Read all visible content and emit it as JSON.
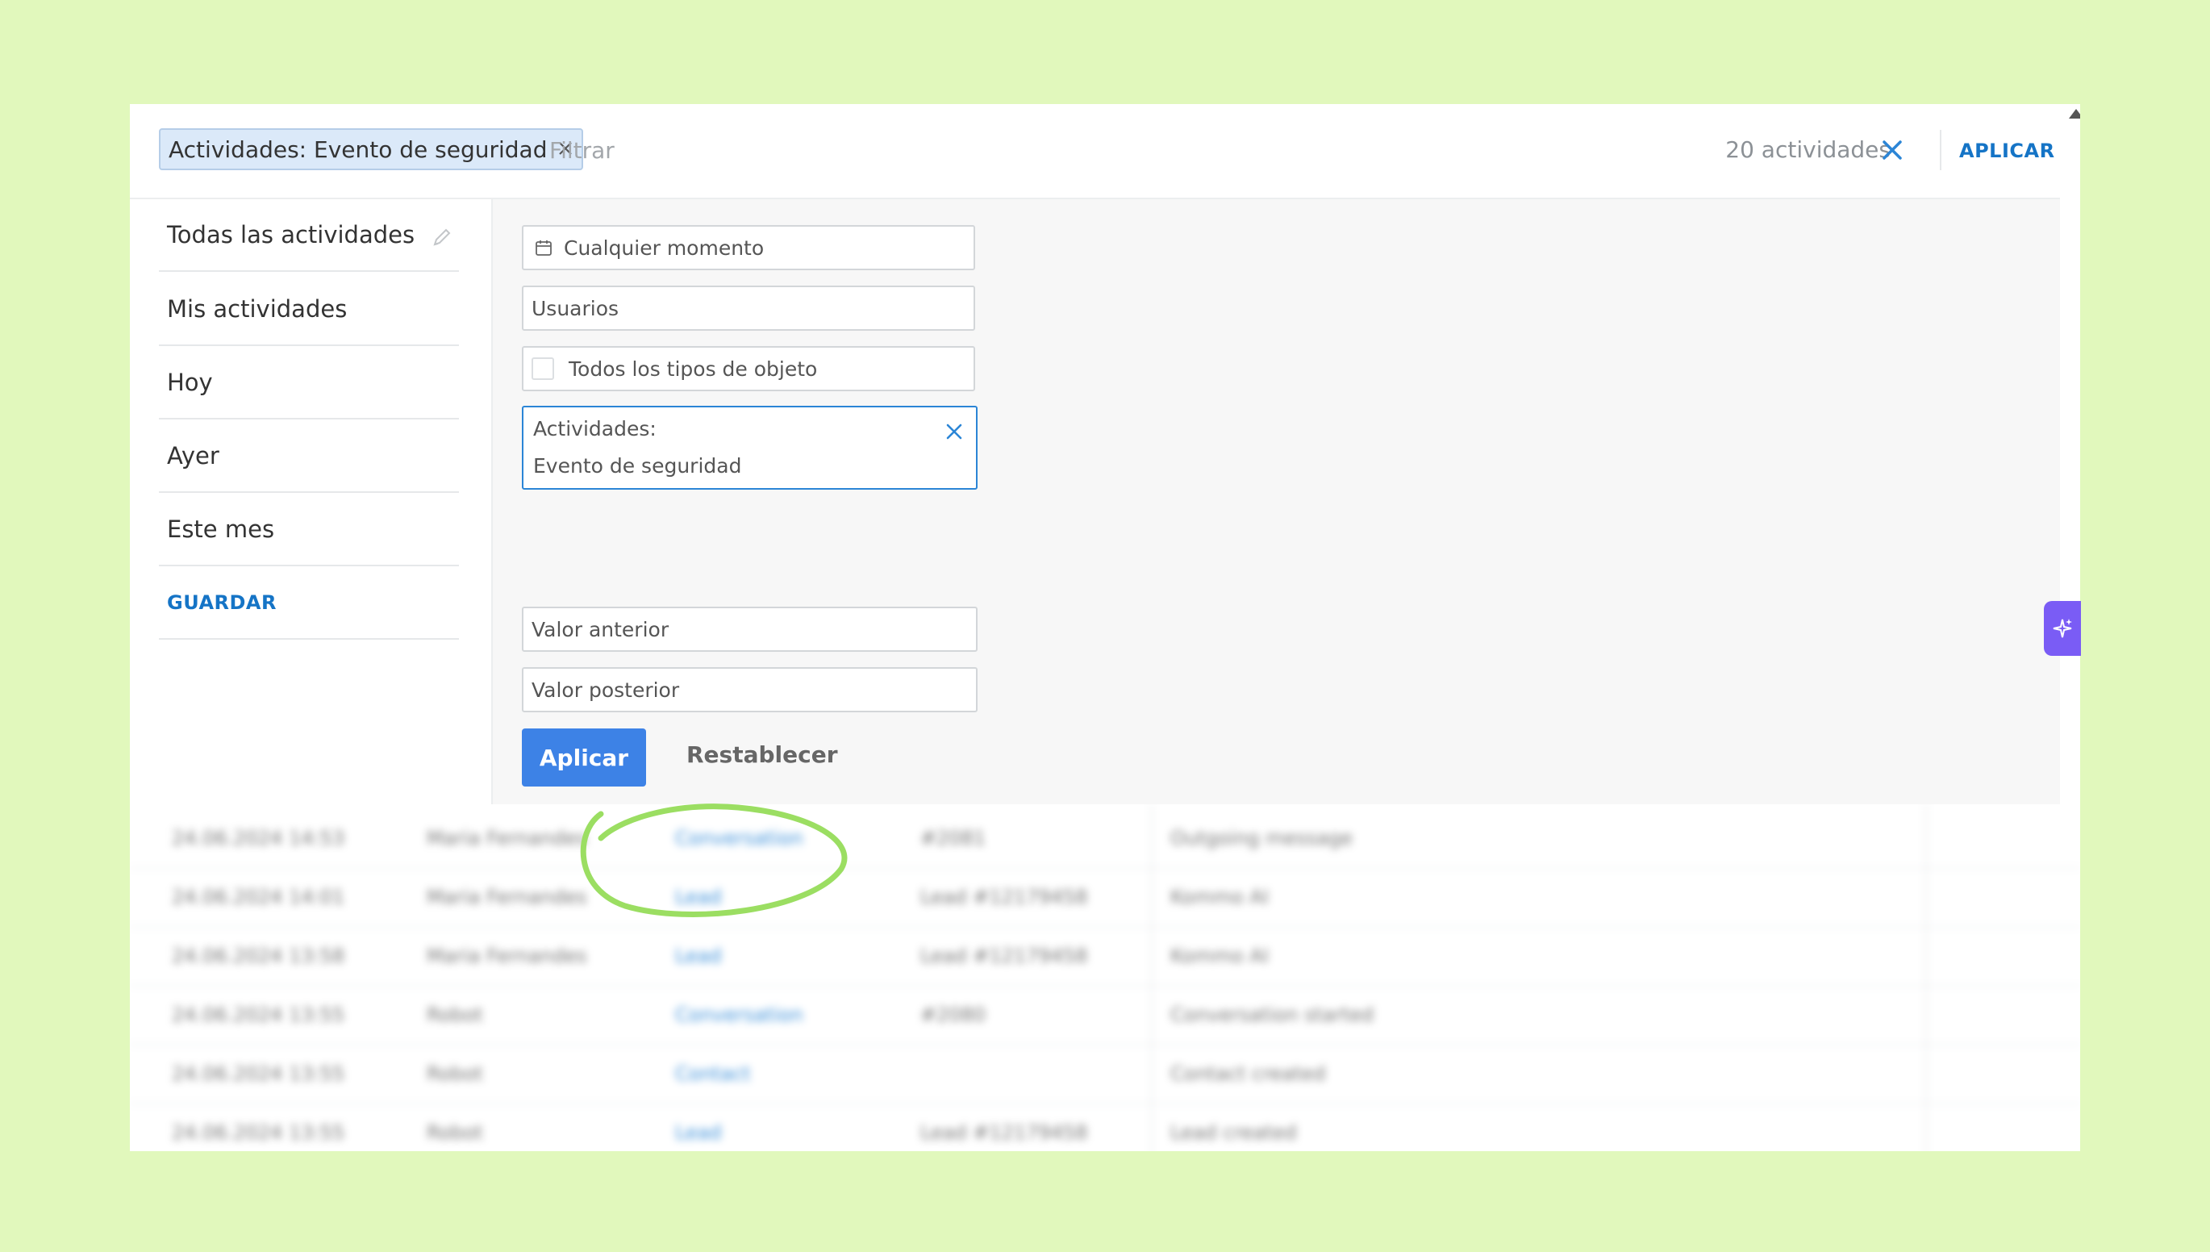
{
  "filter_bar": {
    "chip_label": "Actividades: Evento de seguridad",
    "filter_placeholder": "Filtrar",
    "count_text": "20 actividades",
    "apply_label": "APLICAR"
  },
  "sidebar": {
    "items": [
      {
        "label": "Todas las actividades"
      },
      {
        "label": "Mis actividades"
      },
      {
        "label": "Hoy"
      },
      {
        "label": "Ayer"
      },
      {
        "label": "Este mes"
      }
    ],
    "save_label": "GUARDAR"
  },
  "form": {
    "date_field": "Cualquier momento",
    "users_field": "Usuarios",
    "object_types_field": "Todos los tipos de objeto",
    "activities_field": {
      "line1": "Actividades:",
      "line2": "Evento de seguridad"
    },
    "old_value_field": "Valor anterior",
    "new_value_field": "Valor posterior",
    "apply_button": "Aplicar",
    "reset_button": "Restablecer"
  },
  "table": {
    "rows": [
      {
        "date": "24.06.2024 14:53",
        "user": "Maria Fernandes",
        "entity": "Conversation",
        "object": "#2081",
        "event": "Outgoing message"
      },
      {
        "date": "24.06.2024 14:01",
        "user": "Maria Fernandes",
        "entity": "Lead",
        "object": "Lead #12179458",
        "event": "Kommo AI"
      },
      {
        "date": "24.06.2024 13:58",
        "user": "Maria Fernandes",
        "entity": "Lead",
        "object": "Lead #12179458",
        "event": "Kommo AI"
      },
      {
        "date": "24.06.2024 13:55",
        "user": "Robot",
        "entity": "Conversation",
        "object": "#2080",
        "event": "Conversation started"
      },
      {
        "date": "24.06.2024 13:55",
        "user": "Robot",
        "entity": "Contact",
        "object": "",
        "event": "Contact created"
      },
      {
        "date": "24.06.2024 13:55",
        "user": "Robot",
        "entity": "Lead",
        "object": "Lead #12179458",
        "event": "Lead created"
      }
    ]
  },
  "colors": {
    "background": "#e1f8bc",
    "accent": "#1574c6",
    "primary_button": "#3d82e6",
    "highlight_ring": "#9bde62",
    "ai_widget": "#7a5cf5"
  },
  "icons": {
    "chip_close": "close-icon",
    "clear_filter": "close-icon",
    "edit_preset": "pencil-icon",
    "date": "calendar-icon",
    "ai_widget": "sparkle-icon"
  }
}
